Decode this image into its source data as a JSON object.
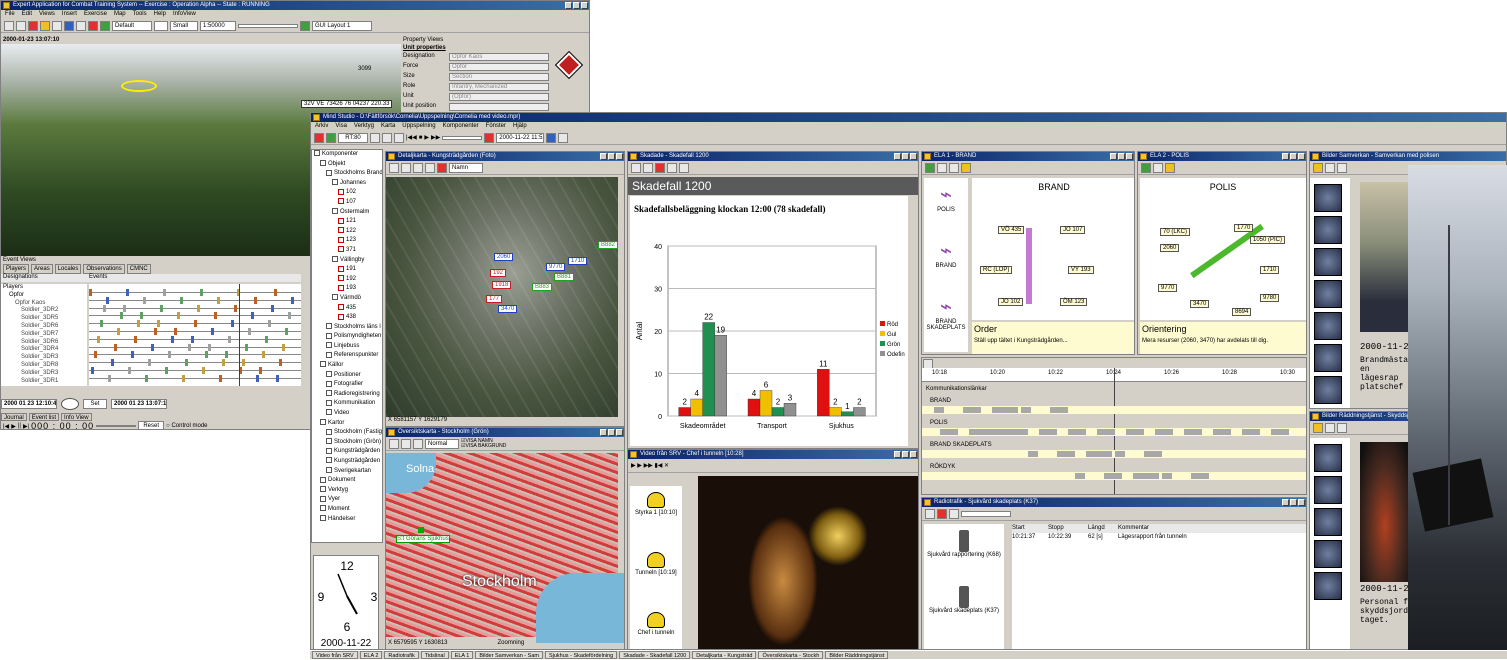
{
  "expert": {
    "title": "Expert Application for Combat Training System  --  Exercise : Operation Alpha  --  State : RUNNING",
    "menu": [
      "File",
      "Edit",
      "Views",
      "Insert",
      "Exercise",
      "Map",
      "Tools",
      "Help",
      "InfoView"
    ],
    "toolbar": {
      "view": "Default",
      "size": "Small",
      "scale": "1:50000",
      "layout": "GUI Layout 1"
    },
    "timestamp": "2000-01-23 13:07:10",
    "map_marker": "3099",
    "map_label": "32V VE 73426 76 04237   220.33",
    "property": {
      "title": "Property Views",
      "section": "Unit properties",
      "rows": [
        {
          "k": "Designation",
          "v": "Opfor Kaos"
        },
        {
          "k": "Force",
          "v": "Opfor"
        },
        {
          "k": "Size",
          "v": "Section"
        },
        {
          "k": "Role",
          "v": "Infantry, Mechanized"
        },
        {
          "k": "Unit",
          "v": "(Opfor)"
        },
        {
          "k": "Unit position",
          "v": ""
        }
      ]
    },
    "events": {
      "title": "Event Views",
      "tabs": [
        "Players",
        "Areas",
        "Locales",
        "Observations",
        "CMNC"
      ],
      "cols": [
        "Designations",
        "Events"
      ],
      "tree": [
        "Players",
        "Opfor",
        "Opfor Kaos",
        "Soldier_3DR2",
        "Soldier_3DR5",
        "Soldier_3DR6",
        "Soldier_3DR7",
        "Soldier_3DR6",
        "Soldier_3DR4",
        "Soldier_3DR3",
        "Soldier_3DR8",
        "Soldier_3DR3",
        "Soldier_3DR1"
      ]
    },
    "time_from": "2000 01 23 12:10:40",
    "set": "Set",
    "time_to": "2000 01 23 13:07:10",
    "bottom_tabs": [
      "Journal",
      "Event list",
      "Info View"
    ],
    "clock": "000 : 00 : 00",
    "reset": "Reset",
    "control": "Control mode"
  },
  "mind": {
    "title": "Mind Studio - D:\\Fältförsök\\Cornelia\\Uppspelning\\Cornelia med video.mpr)",
    "menu": [
      "Arkiv",
      "Visa",
      "Verktyg",
      "Karta",
      "Uppspelning",
      "Komponenter",
      "Fönster",
      "Hjälp"
    ],
    "rt": "RT:80",
    "playtime": "2000-11-22 11:51:00",
    "tree": [
      {
        "t": "Komponenter",
        "l": 0
      },
      {
        "t": "Objekt",
        "l": 1
      },
      {
        "t": "Stockholms Brand",
        "l": 2
      },
      {
        "t": "Johannes",
        "l": 3
      },
      {
        "t": "102",
        "l": 4,
        "r": 1
      },
      {
        "t": "107",
        "l": 4,
        "r": 1
      },
      {
        "t": "Östermalm",
        "l": 3
      },
      {
        "t": "121",
        "l": 4,
        "r": 1
      },
      {
        "t": "122",
        "l": 4,
        "r": 1
      },
      {
        "t": "123",
        "l": 4,
        "r": 1
      },
      {
        "t": "371",
        "l": 4,
        "r": 1
      },
      {
        "t": "Vällingby",
        "l": 3
      },
      {
        "t": "191",
        "l": 4,
        "r": 1
      },
      {
        "t": "192",
        "l": 4,
        "r": 1
      },
      {
        "t": "193",
        "l": 4,
        "r": 1
      },
      {
        "t": "Värmdö",
        "l": 3
      },
      {
        "t": "435",
        "l": 4,
        "r": 1
      },
      {
        "t": "438",
        "l": 4,
        "r": 1
      },
      {
        "t": "Stockholms läns l",
        "l": 2
      },
      {
        "t": "Polismyndigheten",
        "l": 2
      },
      {
        "t": "Linjebuss",
        "l": 2
      },
      {
        "t": "Referenspunkter",
        "l": 2
      },
      {
        "t": "Källor",
        "l": 1
      },
      {
        "t": "Positioner",
        "l": 2
      },
      {
        "t": "Fotografier",
        "l": 2
      },
      {
        "t": "Radioregistrering",
        "l": 2
      },
      {
        "t": "Kommunikation",
        "l": 2
      },
      {
        "t": "Video",
        "l": 2
      },
      {
        "t": "Kartor",
        "l": 1
      },
      {
        "t": "Stockholm (Fastig",
        "l": 2
      },
      {
        "t": "Stockholm (Grön)",
        "l": 2
      },
      {
        "t": "Kungsträdgården",
        "l": 2
      },
      {
        "t": "Kungsträdgården",
        "l": 2
      },
      {
        "t": "Sverigekartan",
        "l": 2
      },
      {
        "t": "Dokument",
        "l": 1
      },
      {
        "t": "Verktyg",
        "l": 1
      },
      {
        "t": "Vyer",
        "l": 1
      },
      {
        "t": "Moment",
        "l": 1
      },
      {
        "t": "Händelser",
        "l": 1
      }
    ],
    "clockdate": "2000-11-22",
    "detail": {
      "title": "Detaljkarta - Kungsträdgården (Foto)",
      "combo": "Namn",
      "coords": "X 6581157 Y 1629179",
      "tags": [
        "2060",
        "192",
        "1918",
        "177",
        "1710",
        "3470",
        "9770",
        "B881",
        "B882",
        "B883"
      ]
    },
    "overview": {
      "title": "Översiktskarta - Stockholm (Grön)",
      "combo": "Normal",
      "checks": [
        "VISA NAMN",
        "VISA BAKGRUND"
      ],
      "labels": [
        "Solna",
        "S:t Görans Sjukhus",
        "Stockholm"
      ],
      "coords": "X 6579595 Y 1630813",
      "status": "Zoomning"
    },
    "skade": {
      "wtitle": "Skadade - Skadefall 1200",
      "heading": "Skadefall 1200"
    },
    "video": {
      "wtitle": "Video från SRV - Chef i tunneln [10:28]",
      "items": [
        "Styrka 1 [10:10]",
        "Tunneln [10:19]",
        "Chef i tunneln"
      ]
    },
    "ela1": {
      "wtitle": "ELA 1 - BRAND",
      "label": "BRAND",
      "side": [
        "POLIS",
        "BRAND",
        "BRAND SKADEPLATS"
      ],
      "units": [
        "VÖ 435",
        "JO 107",
        "RC (LOP)",
        "VY 193",
        "JO 102",
        "ÖM 123"
      ],
      "order_title": "Order",
      "order_text": "Ställ upp tältet i Kungsträdgården..."
    },
    "ela2": {
      "wtitle": "ELA 2 - POLIS",
      "label": "POLIS",
      "units": [
        "70 (LKC)",
        "1770",
        "1050 (PIC)",
        "2060",
        "1710",
        "9770",
        "9780",
        "3470",
        "8694"
      ],
      "order_title": "Orientering",
      "order_text": "Mera resurser (2060, 3470) har avdelats till dig."
    },
    "comm": {
      "ticks": [
        "10:18",
        "10:20",
        "10:22",
        "10:24",
        "10:26",
        "10:28",
        "10:30"
      ],
      "title": "Kommunikationslänkar",
      "rows": [
        "BRAND",
        "POLIS",
        "BRAND SKADEPLATS",
        "RÖKDYK"
      ]
    },
    "radio": {
      "wtitle": "Radiotrafik - Sjukvård skadeplats (K37)",
      "cols": [
        "Start",
        "Stopp",
        "Längd",
        "Kommentar"
      ],
      "row": [
        "10:21:37",
        "10:22:39",
        "62 [s]",
        "Lägesrapport från tunneln"
      ],
      "items": [
        "Sjukvård rapportering (K68)",
        "Sjukvård skadeplats (K37)"
      ]
    },
    "photos1": {
      "wtitle": "Bilder Samverkan - Samverkan med polisen",
      "date": "2000-11-22",
      "text": "Brandmästar en lägesrap platschef"
    },
    "photos2": {
      "wtitle": "Bilder Räddningstjänst - Skyddsjordning",
      "date": "2000-11-22",
      "text": "Personal f skyddsjord taget."
    },
    "taskbar": [
      "Video från SRV",
      "ELA 2",
      "Radiotrafik",
      "Tidslinal",
      "ELA 1",
      "Bilder Samverkan - Sam",
      "Sjukhus - Skadefördelning",
      "Skadade - Skadefall 1200",
      "Detaljkarta - Kungsträd",
      "Översiktskarta - Stockh",
      "Bilder Räddningstjänst"
    ]
  },
  "chart_data": {
    "type": "bar",
    "title": "Skadefallsbeläggning klockan 12:00 (78 skadefall)",
    "ylabel": "Antal",
    "ylim": [
      0,
      40
    ],
    "yticks": [
      0,
      10,
      20,
      30,
      40
    ],
    "categories": [
      "Skadeområdet",
      "Transport",
      "Sjukhus"
    ],
    "series": [
      {
        "name": "Röd",
        "color": "#e01010",
        "values": [
          2,
          4,
          11
        ]
      },
      {
        "name": "Gul",
        "color": "#f0c000",
        "values": [
          4,
          6,
          2
        ]
      },
      {
        "name": "Grön",
        "color": "#209050",
        "values": [
          22,
          2,
          1
        ]
      },
      {
        "name": "Odefin",
        "color": "#909090",
        "values": [
          19,
          3,
          2
        ]
      }
    ]
  }
}
